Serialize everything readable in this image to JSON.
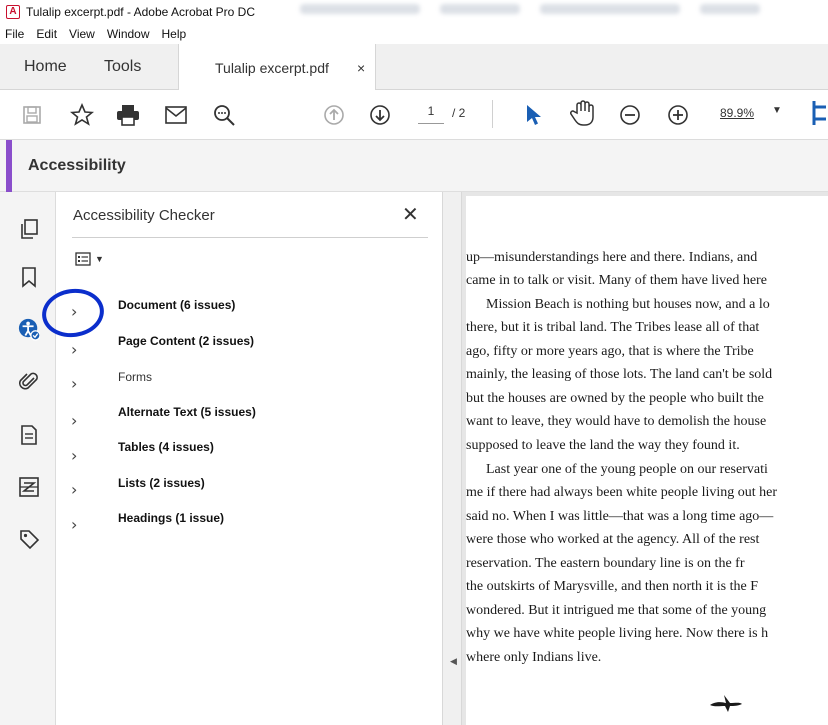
{
  "window": {
    "title": "Tulalip excerpt.pdf - Adobe Acrobat Pro DC"
  },
  "menu": [
    "File",
    "Edit",
    "View",
    "Window",
    "Help"
  ],
  "tabs": {
    "home": "Home",
    "tools": "Tools",
    "document": "Tulalip excerpt.pdf",
    "close": "×"
  },
  "toolbar": {
    "icons": [
      "save-icon",
      "bookmark-star-icon",
      "print-icon",
      "email-icon",
      "search-zoom-icon",
      "page-up-icon",
      "page-down-icon",
      "select-arrow-icon",
      "hand-tool-icon",
      "zoom-out-icon",
      "zoom-in-icon",
      "fit-page-icon"
    ],
    "page_current": "1",
    "page_total": "/ 2",
    "zoom": "89.9%"
  },
  "accessibility": {
    "header": "Accessibility"
  },
  "checker": {
    "title": "Accessibility Checker",
    "close": "✕",
    "items": [
      {
        "label": "Document (6 issues)",
        "bold": true
      },
      {
        "label": "Page Content (2 issues)",
        "bold": true
      },
      {
        "label": "Forms",
        "bold": false
      },
      {
        "label": "Alternate Text (5 issues)",
        "bold": true
      },
      {
        "label": "Tables (4 issues)",
        "bold": true
      },
      {
        "label": "Lists (2 issues)",
        "bold": true
      },
      {
        "label": "Headings (1 issue)",
        "bold": true
      }
    ]
  },
  "colors": {
    "accent": "#8a4ecb",
    "annotation": "#0b2ecc",
    "brand": "#c8102e"
  },
  "document": {
    "lines": [
      "up—misunderstandings here and there. Indians, and",
      "came in to talk or visit. Many of them have lived here",
      "Mission Beach is nothing but houses now, and a lo",
      "there, but it is tribal land. The Tribes lease all of that",
      "ago, fifty or more years ago, that is where the Tribe",
      "mainly, the leasing of those lots. The land can't be sold",
      "but the houses are owned by the people who built the",
      "want to leave, they would have to demolish the house",
      "supposed to leave the land the way they found it.",
      "Last year one of the young people on our reservati",
      "me if there had always been white people living out her",
      "said no. When I was little—that was a long time ago—",
      "were those who worked at the agency. All of the rest",
      "reservation. The eastern boundary line is on the fr",
      "the outskirts of Marysville, and then north it is the F",
      "wondered. But it intrigued me that some of the young",
      "why we have white people living here. Now there is h",
      "where only Indians live."
    ]
  }
}
